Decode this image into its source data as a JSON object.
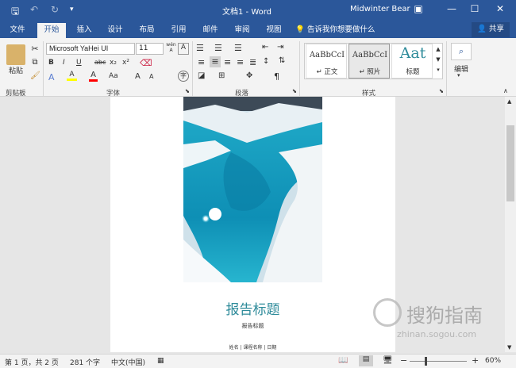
{
  "window": {
    "title": "文档1 - Word",
    "user": "Midwinter Bear",
    "qa_save": "🖫",
    "qa_undo": "↶",
    "qa_redo": "↻",
    "qa_more": "▾",
    "btn_ribbon_opts": "▣",
    "btn_min": "—",
    "btn_max": "☐",
    "btn_close": "✕"
  },
  "tabs": [
    "文件",
    "开始",
    "插入",
    "设计",
    "布局",
    "引用",
    "邮件",
    "审阅",
    "视图"
  ],
  "tell_me": "告诉我你想要做什么",
  "share": "共享",
  "ribbon": {
    "clipboard": {
      "paste": "粘贴",
      "label": "剪贴板"
    },
    "font": {
      "family": "Microsoft YaHei UI",
      "size": "11",
      "label": "字体",
      "row1": [
        "B",
        "I",
        "U",
        "abc",
        "x₂",
        "x²"
      ],
      "row2": [
        "A",
        "A",
        "A",
        "Aa",
        "A",
        "A",
        "字"
      ]
    },
    "paragraph": {
      "label": "段落"
    },
    "styles": {
      "label": "样式",
      "items": [
        {
          "sample": "AaBbCcI",
          "name": "↵ 正文"
        },
        {
          "sample": "AaBbCcI",
          "name": "↵ 照片"
        },
        {
          "sample": "Aat",
          "name": "标题"
        }
      ]
    },
    "editing": {
      "label": "编辑"
    }
  },
  "document": {
    "title": "报告标题",
    "subtitle": "报告标题",
    "meta": "姓名 | 课程名称 | 日期"
  },
  "status": {
    "page": "第 1 页，共 2 页",
    "words": "281 个字",
    "language": "中文(中国)",
    "zoom": "60%",
    "zoom_level": 0.6
  },
  "watermark": {
    "brand": "搜狗指南",
    "url": "zhinan.sogou.com"
  },
  "colors": {
    "accent": "#2b579a",
    "title": "#2e8b9a",
    "highlight": "#ffff00",
    "font_red": "#ff0000"
  }
}
